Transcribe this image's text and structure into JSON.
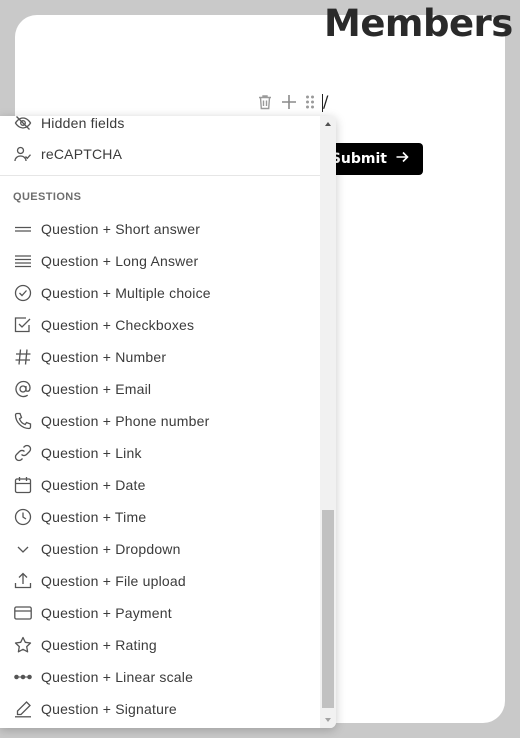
{
  "page": {
    "title": "Members"
  },
  "editor": {
    "typed_text": "/"
  },
  "submit": {
    "label": "Submit"
  },
  "dropdown": {
    "top_items": [
      {
        "label": "Hidden fields",
        "icon": "eye-off-icon"
      },
      {
        "label": "reCAPTCHA",
        "icon": "user-check-icon"
      }
    ],
    "section_heading": "QUESTIONS",
    "question_items": [
      {
        "label": "Question + Short answer",
        "icon": "short-answer-icon"
      },
      {
        "label": "Question + Long Answer",
        "icon": "long-answer-icon"
      },
      {
        "label": "Question + Multiple choice",
        "icon": "circle-check-icon"
      },
      {
        "label": "Question + Checkboxes",
        "icon": "checkbox-icon"
      },
      {
        "label": "Question + Number",
        "icon": "hash-icon"
      },
      {
        "label": "Question + Email",
        "icon": "at-sign-icon"
      },
      {
        "label": "Question + Phone number",
        "icon": "phone-icon"
      },
      {
        "label": "Question + Link",
        "icon": "link-icon"
      },
      {
        "label": "Question + Date",
        "icon": "calendar-icon"
      },
      {
        "label": "Question + Time",
        "icon": "clock-icon"
      },
      {
        "label": "Question + Dropdown",
        "icon": "chevron-down-icon"
      },
      {
        "label": "Question + File upload",
        "icon": "upload-icon"
      },
      {
        "label": "Question + Payment",
        "icon": "credit-card-icon"
      },
      {
        "label": "Question + Rating",
        "icon": "star-icon"
      },
      {
        "label": "Question + Linear scale",
        "icon": "linear-scale-icon"
      },
      {
        "label": "Question + Signature",
        "icon": "pen-icon"
      }
    ]
  },
  "colors": {
    "background": "#c9c9c9",
    "card": "#ffffff",
    "submit_bg": "#000000",
    "text": "#3b3b3b"
  }
}
